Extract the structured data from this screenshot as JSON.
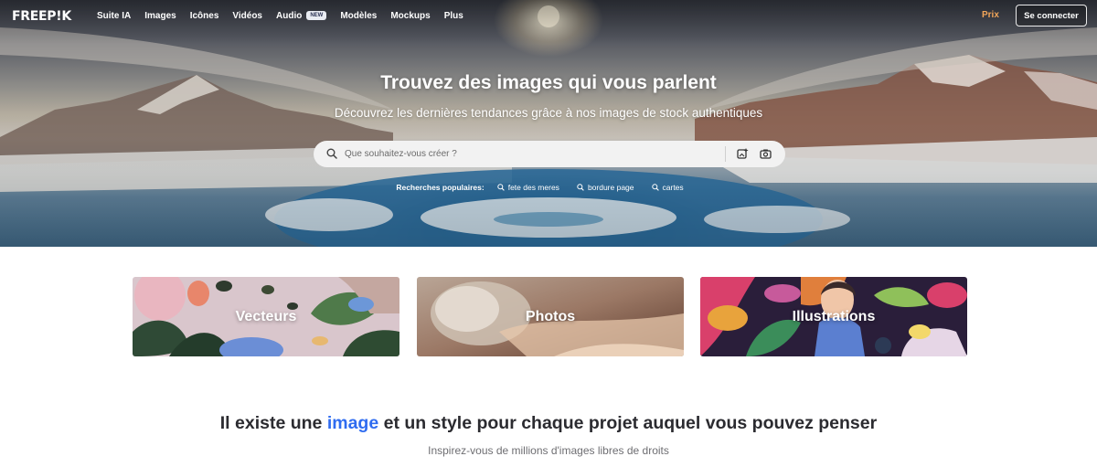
{
  "nav": {
    "logo": "FREEP!K",
    "items": [
      {
        "label": "Suite IA"
      },
      {
        "label": "Images"
      },
      {
        "label": "Icônes"
      },
      {
        "label": "Vidéos"
      },
      {
        "label": "Audio",
        "badge": "NEW"
      },
      {
        "label": "Modèles"
      },
      {
        "label": "Mockups"
      },
      {
        "label": "Plus"
      }
    ],
    "pricing": "Prix",
    "login": "Se connecter"
  },
  "hero": {
    "title": "Trouvez des images qui vous parlent",
    "subtitle": "Découvrez les dernières tendances grâce à nos images de stock authentiques",
    "search": {
      "placeholder": "Que souhaitez-vous créer ?",
      "value": ""
    },
    "popular": {
      "label": "Recherches populaires:",
      "items": [
        "fete des meres",
        "bordure page",
        "cartes"
      ]
    }
  },
  "categories": [
    {
      "label": "Vecteurs"
    },
    {
      "label": "Photos"
    },
    {
      "label": "Illustrations"
    }
  ],
  "section": {
    "title_before": "Il existe une ",
    "title_highlight": "image",
    "title_after": " et un style pour chaque projet auquel vous pouvez penser",
    "subtitle": "Inspirez-vous de millions d'images libres de droits"
  },
  "colors": {
    "pricing": "#f2a65a",
    "highlight": "#2f6cf0"
  }
}
